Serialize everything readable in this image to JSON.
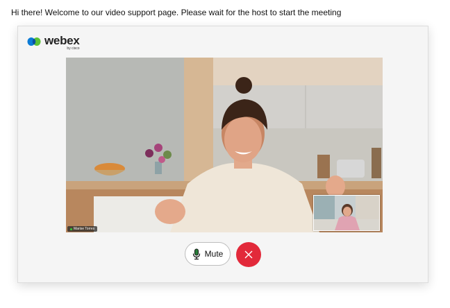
{
  "header": {
    "message": "Hi there! Welcome to our video support page. Please wait for the host to start the meeting"
  },
  "brand": {
    "name": "webex",
    "byline": "by cisco",
    "accent": "#0b7bd6"
  },
  "video": {
    "participant_name": "Marise Torres"
  },
  "controls": {
    "mute_label": "Mute",
    "end_color": "#e2293a"
  }
}
